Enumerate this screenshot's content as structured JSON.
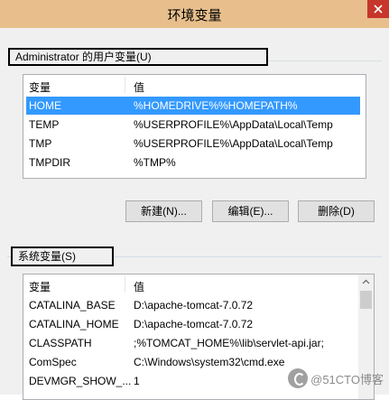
{
  "window": {
    "title": "环境变量"
  },
  "user_vars": {
    "group_label": "Administrator 的用户变量(U)",
    "col_variable": "变量",
    "col_value": "值",
    "rows": [
      {
        "name": "HOME",
        "value": "%HOMEDRIVE%%HOMEPATH%",
        "selected": true
      },
      {
        "name": "TEMP",
        "value": "%USERPROFILE%\\AppData\\Local\\Temp"
      },
      {
        "name": "TMP",
        "value": "%USERPROFILE%\\AppData\\Local\\Temp"
      },
      {
        "name": "TMPDIR",
        "value": "%TMP%"
      }
    ],
    "buttons": {
      "new": "新建(N)...",
      "edit": "编辑(E)...",
      "delete": "删除(D)"
    }
  },
  "system_vars": {
    "group_label": "系统变量(S)",
    "col_variable": "变量",
    "col_value": "值",
    "rows": [
      {
        "name": "CATALINA_BASE",
        "value": "D:\\apache-tomcat-7.0.72"
      },
      {
        "name": "CATALINA_HOME",
        "value": "D:\\apache-tomcat-7.0.72"
      },
      {
        "name": "CLASSPATH",
        "value": ";%TOMCAT_HOME%\\lib\\servlet-api.jar;"
      },
      {
        "name": "ComSpec",
        "value": "C:\\Windows\\system32\\cmd.exe"
      },
      {
        "name": "DEVMGR_SHOW_...",
        "value": "1"
      }
    ]
  },
  "watermark": {
    "text": "@51CTO博客"
  },
  "colors": {
    "titlebar": "#e8bf8c",
    "close": "#c7362b",
    "selection": "#3399ff"
  }
}
